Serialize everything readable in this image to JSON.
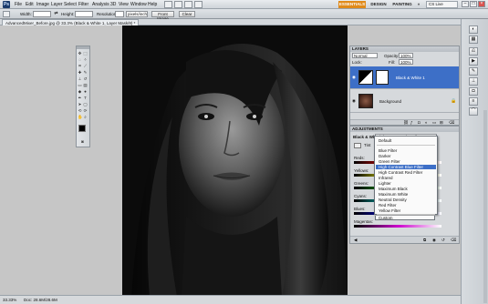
{
  "menubar": {
    "logo": "Ps",
    "items": [
      "File",
      "Edit",
      "Image",
      "Layer",
      "Select",
      "Filter",
      "Analysis",
      "3D",
      "View",
      "Window",
      "Help"
    ],
    "workspaces": [
      "ESSENTIALS",
      "DESIGN",
      "PAINTING"
    ],
    "active_workspace": "ESSENTIALS",
    "more_label": "»",
    "search_label": "CS Live"
  },
  "optbar": {
    "width_label": "Width:",
    "height_label": "Height:",
    "resolution_label": "Resolution:",
    "resolution_unit": "pixels/inch",
    "front_image_label": "Front Image",
    "clear_label": "Clear"
  },
  "document": {
    "tab_title": "AdvancedMixer_Before.jpg @ 33.3% (Black & White 1, Layer Mask/8) *",
    "status_zoom": "33.33%",
    "status_doc": "Doc: 28.6M/28.6M"
  },
  "layers_panel": {
    "title": "LAYERS",
    "blend_mode": "Normal",
    "opacity_label": "Opacity:",
    "opacity_value": "100%",
    "lock_label": "Lock:",
    "fill_label": "Fill:",
    "fill_value": "100%",
    "layers": [
      {
        "name": "Black & White 1",
        "selected": true
      },
      {
        "name": "Background",
        "selected": false
      }
    ]
  },
  "adjust_panel": {
    "title": "ADJUSTMENTS",
    "preset_label": "Black & White",
    "preset_value": "High Contrast Blue Filter",
    "tint_label": "Tint",
    "auto_label": "Auto",
    "sliders": [
      "Reds:",
      "Yellows:",
      "Greens:",
      "Cyans:",
      "Blues:",
      "Magentas:"
    ]
  },
  "preset_menu": {
    "items": [
      "Default",
      "Blue Filter",
      "Darker",
      "Green Filter",
      "High Contrast Blue Filter",
      "High Contrast Red Filter",
      "Infrared",
      "Lighter",
      "Maximum Black",
      "Maximum White",
      "Neutral Density",
      "Red Filter",
      "Yellow Filter",
      "Custom"
    ],
    "selected": "High Contrast Blue Filter"
  },
  "colors": {
    "accent": "#e08a1a",
    "selection": "#3d6fc7",
    "foreground_swatch": "#000000",
    "background_swatch": "#ffffff"
  }
}
